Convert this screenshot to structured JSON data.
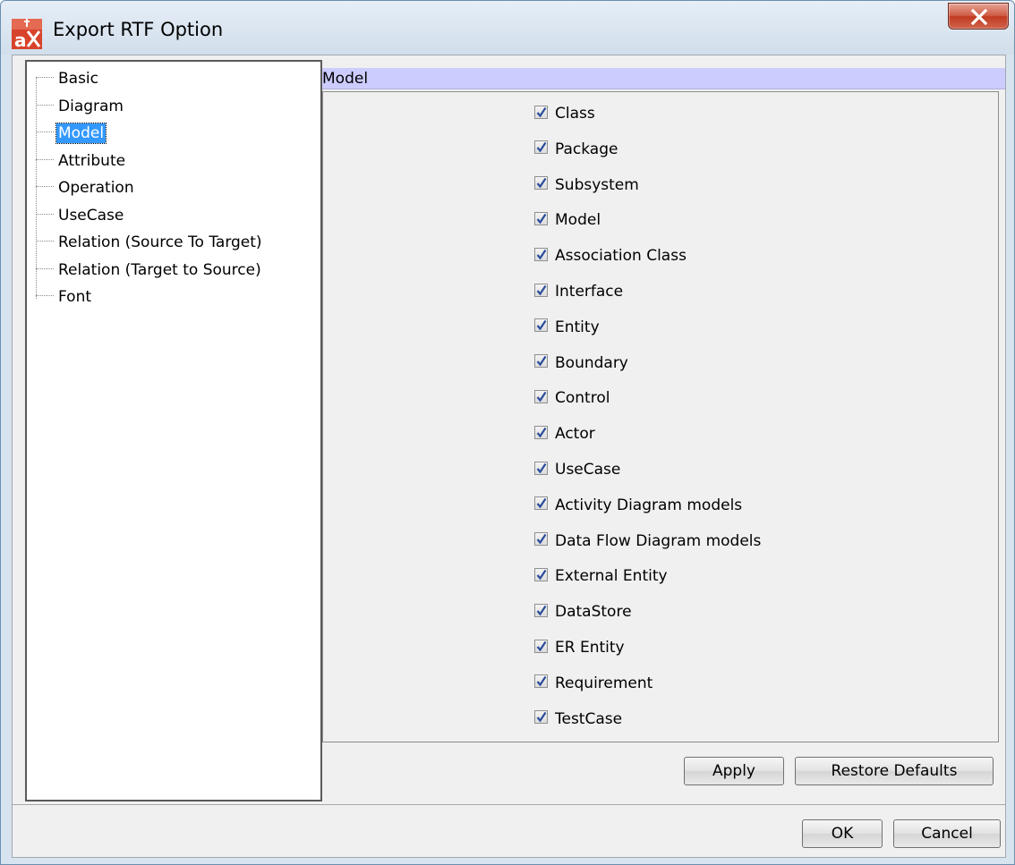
{
  "window": {
    "title": "Export RTF Option"
  },
  "tree": {
    "items": [
      {
        "label": "Basic"
      },
      {
        "label": "Diagram"
      },
      {
        "label": "Model"
      },
      {
        "label": "Attribute"
      },
      {
        "label": "Operation"
      },
      {
        "label": "UseCase"
      },
      {
        "label": "Relation (Source To Target)"
      },
      {
        "label": "Relation (Target to Source)"
      },
      {
        "label": "Font"
      }
    ],
    "selected": "Model"
  },
  "section": {
    "title": "Model"
  },
  "options": [
    {
      "label": "Class",
      "checked": true
    },
    {
      "label": "Package",
      "checked": true
    },
    {
      "label": "Subsystem",
      "checked": true
    },
    {
      "label": "Model",
      "checked": true
    },
    {
      "label": "Association Class",
      "checked": true
    },
    {
      "label": "Interface",
      "checked": true
    },
    {
      "label": "Entity",
      "checked": true
    },
    {
      "label": "Boundary",
      "checked": true
    },
    {
      "label": "Control",
      "checked": true
    },
    {
      "label": "Actor",
      "checked": true
    },
    {
      "label": "UseCase",
      "checked": true
    },
    {
      "label": "Activity Diagram models",
      "checked": true
    },
    {
      "label": "Data Flow Diagram models",
      "checked": true
    },
    {
      "label": "External Entity",
      "checked": true
    },
    {
      "label": "DataStore",
      "checked": true
    },
    {
      "label": "ER Entity",
      "checked": true
    },
    {
      "label": "Requirement",
      "checked": true
    },
    {
      "label": "TestCase",
      "checked": true
    }
  ],
  "buttons": {
    "apply": "Apply",
    "restore_defaults": "Restore Defaults",
    "ok": "OK",
    "cancel": "Cancel"
  },
  "colors": {
    "selection": "#3399ff",
    "section_header": "#ccccff",
    "close_button": "#c8452c"
  }
}
